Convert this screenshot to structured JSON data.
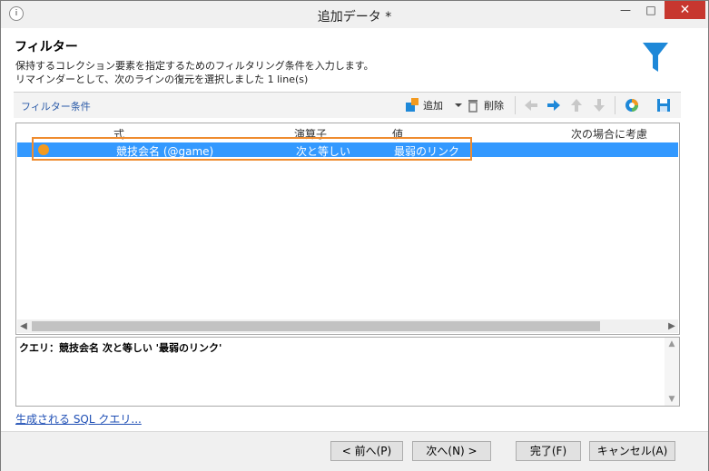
{
  "window": {
    "title": "追加データ *",
    "app_icon": "i",
    "minimize_glyph": "—",
    "maximize_glyph": "□",
    "close_glyph": "✕"
  },
  "header": {
    "title": "フィルター",
    "description_line1": "保持するコレクション要素を指定するためのフィルタリング条件を入力します。",
    "description_line2": "リマインダーとして、次のラインの復元を選択しました 1 line(s)",
    "icon": "funnel-icon"
  },
  "toolbar": {
    "section_label": "フィルター条件",
    "add_label": "追加",
    "delete_label": "削除",
    "icons": [
      "add-condition-icon",
      "dropdown-arrow-icon",
      "trash-icon",
      "arrow-left-icon",
      "arrow-right-icon",
      "arrow-up-icon",
      "arrow-down-icon",
      "pie-chart-icon",
      "save-icon"
    ]
  },
  "grid": {
    "columns": [
      "式",
      "演算子",
      "値",
      "次の場合に考慮"
    ],
    "rows": [
      {
        "expression": "競技会名 (@game)",
        "operator": "次と等しい",
        "value": "最弱のリンク",
        "condition": "",
        "selected": true
      }
    ]
  },
  "query": {
    "text": "クエリ：競技会名 次と等しい '最弱のリンク'"
  },
  "sql_link": "生成される SQL クエリ...",
  "footer": {
    "back_label": "< 前へ(P)",
    "next_label": "次へ(N) >",
    "finish_label": "完了(F)",
    "cancel_label": "キャンセル(A)"
  },
  "colors": {
    "selection": "#3399ff",
    "highlight_border": "#ef8c2f",
    "accent_blue": "#1e88d8",
    "close_red": "#c7372f"
  }
}
